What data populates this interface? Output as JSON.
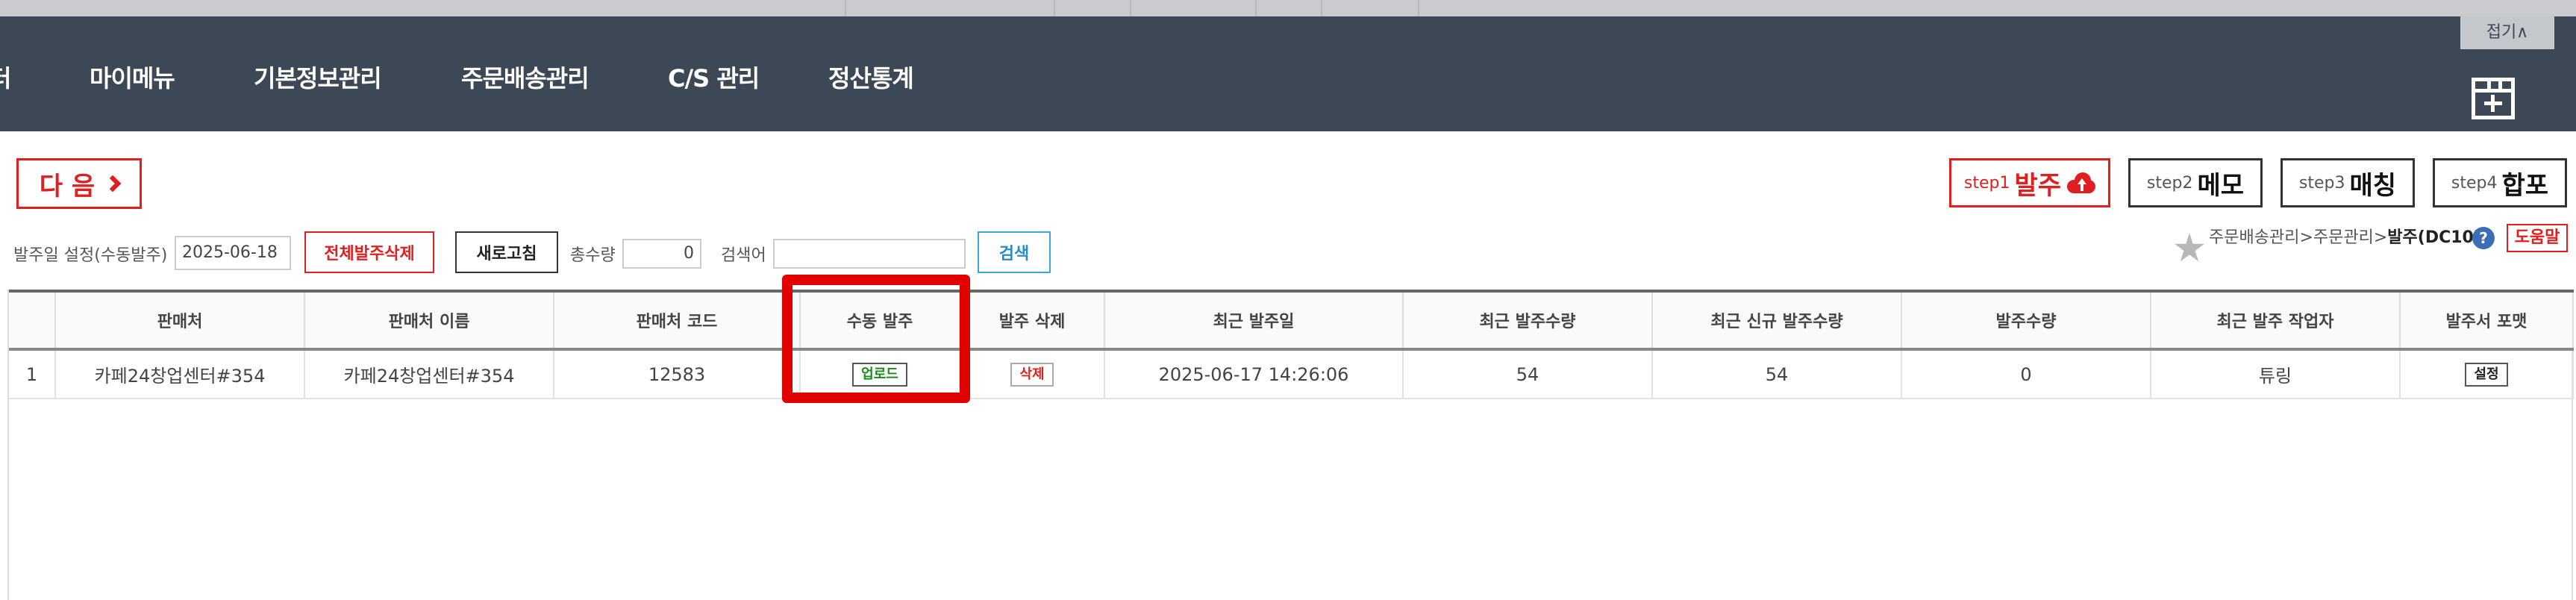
{
  "nav": {
    "partial_item": "터",
    "items": [
      "마이메뉴",
      "기본정보관리",
      "주문배송관리",
      "C/S 관리",
      "정산통계"
    ],
    "fold_label": "접기∧"
  },
  "toolbar": {
    "next_label": "다 음",
    "steps": [
      {
        "small": "step1",
        "big": "발주"
      },
      {
        "small": "step2",
        "big": "메모"
      },
      {
        "small": "step3",
        "big": "매칭"
      },
      {
        "small": "step4",
        "big": "합포"
      }
    ]
  },
  "filters": {
    "date_label": "발주일 설정(수동발주)",
    "date_value": "2025-06-18",
    "delete_all_label": "전체발주삭제",
    "refresh_label": "새로고침",
    "total_qty_label": "총수량",
    "total_qty_value": "0",
    "search_label": "검색어",
    "search_value": "",
    "search_button": "검색"
  },
  "breadcrumb": {
    "path": "주문배송관리>주문관리>",
    "current": "발주(DC10)",
    "help_icon": "?",
    "help_label": "도움말"
  },
  "table": {
    "headers": [
      "",
      "판매처",
      "판매처 이름",
      "판매처 코드",
      "수동 발주",
      "발주 삭제",
      "최근 발주일",
      "최근 발주수량",
      "최근 신규 발주수량",
      "발주수량",
      "최근 발주 작업자",
      "발주서 포맷"
    ],
    "rows": [
      {
        "no": "1",
        "seller": "카페24창업센터#354",
        "seller_name": "카페24창업센터#354",
        "seller_code": "12583",
        "upload_btn": "업로드",
        "delete_btn": "삭제",
        "last_date": "2025-06-17 14:26:06",
        "last_qty": "54",
        "last_new_qty": "54",
        "order_qty": "0",
        "worker": "튜링",
        "format_btn": "설정"
      }
    ]
  },
  "colors": {
    "nav_bg": "#3c4856",
    "accent_red": "#e02020",
    "highlight_red": "#e00000",
    "search_blue": "#3fa6d8"
  },
  "icons": [
    "chevron-right-icon",
    "upload-cloud-icon",
    "grid-add-icon",
    "star-icon",
    "help-icon"
  ]
}
